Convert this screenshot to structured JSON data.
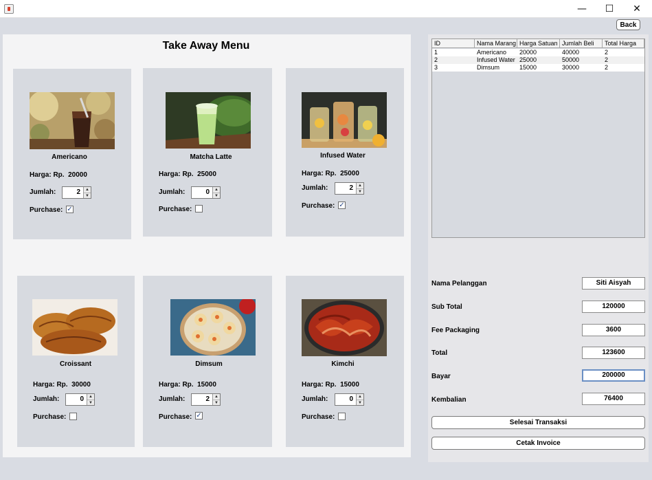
{
  "window": {
    "minimize_glyph": "—",
    "maximize_glyph": "☐",
    "close_glyph": "✕",
    "back_label": "Back"
  },
  "menu": {
    "title": "Take Away Menu",
    "price_label": "Harga: Rp.",
    "qty_label": "Jumlah:",
    "purchase_label": "Purchase:",
    "items": [
      {
        "name": "Americano",
        "price": "20000",
        "qty": "2",
        "purchase": "✓"
      },
      {
        "name": "Matcha Latte",
        "price": "25000",
        "qty": "0",
        "purchase": ""
      },
      {
        "name": "Infused Water",
        "price": "25000",
        "qty": "2",
        "purchase": "✓"
      },
      {
        "name": "Croissant",
        "price": "30000",
        "qty": "0",
        "purchase": ""
      },
      {
        "name": "Dimsum",
        "price": "15000",
        "qty": "2",
        "purchase": "✓"
      },
      {
        "name": "Kimchi",
        "price": "15000",
        "qty": "0",
        "purchase": ""
      }
    ]
  },
  "table": {
    "columns": [
      "ID",
      "Nama Marang",
      "Harga Satuan",
      "Jumlah Beli",
      "Total Harga"
    ],
    "rows": [
      [
        "1",
        "Americano",
        "20000",
        "40000",
        "2"
      ],
      [
        "2",
        "Infused Water",
        "25000",
        "50000",
        "2"
      ],
      [
        "3",
        "Dimsum",
        "15000",
        "30000",
        "2"
      ]
    ]
  },
  "form": {
    "nama_pelanggan_label": "Nama Pelanggan",
    "nama_pelanggan_value": "Siti Aisyah",
    "sub_total_label": "Sub Total",
    "sub_total_value": "120000",
    "fee_packaging_label": "Fee Packaging",
    "fee_packaging_value": "3600",
    "total_label": "Total",
    "total_value": "123600",
    "bayar_label": "Bayar",
    "bayar_value": "200000",
    "kembalian_label": "Kembalian",
    "kembalian_value": "76400"
  },
  "actions": {
    "selesai_label": "Selesai Transaksi",
    "cetak_label": "Cetak Invoice"
  },
  "colors": {
    "panel_bg": "#d7dae0",
    "focus_border": "#6a8fc4"
  }
}
